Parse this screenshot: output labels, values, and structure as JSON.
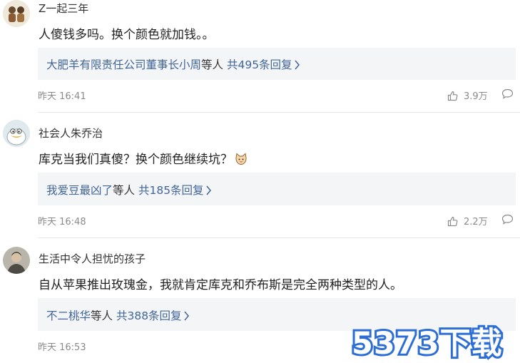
{
  "comments": [
    {
      "username": "Z一起三年",
      "avatar_icon": "avatar-two-figures",
      "content": "人傻钱多吗。换个颜色就加钱。。",
      "reply_prefix": "大肥羊有限责任公司董事长小周",
      "reply_mid": "等人",
      "reply_count_text": "共495条回复",
      "time": "昨天 16:41",
      "likes": "3.9万"
    },
    {
      "username": "社会人朱乔治",
      "avatar_icon": "avatar-cartoon-duck",
      "content": "库克当我们真傻？换个颜色继续坑？",
      "content_emoji": "cat-face-emoji",
      "reply_prefix": "我爱豆最凶了",
      "reply_mid": "等人",
      "reply_count_text": "共185条回复",
      "time": "昨天 16:48",
      "likes": "2.2万"
    },
    {
      "username": "生活中令人担忧的孩子",
      "avatar_icon": "avatar-person-photo",
      "content": "自从苹果推出玫瑰金，我就肯定库克和乔布斯是完全两种类型的人。",
      "reply_prefix": "不二桃华",
      "reply_mid": "等人",
      "reply_count_text": "共388条回复",
      "time": "昨天 16:53"
    }
  ],
  "watermark": "5373下载",
  "colors": {
    "link": "#406599",
    "reply_bg": "#f4f5f7",
    "meta": "#8a8a8a",
    "watermark": "#2d6fd6"
  }
}
